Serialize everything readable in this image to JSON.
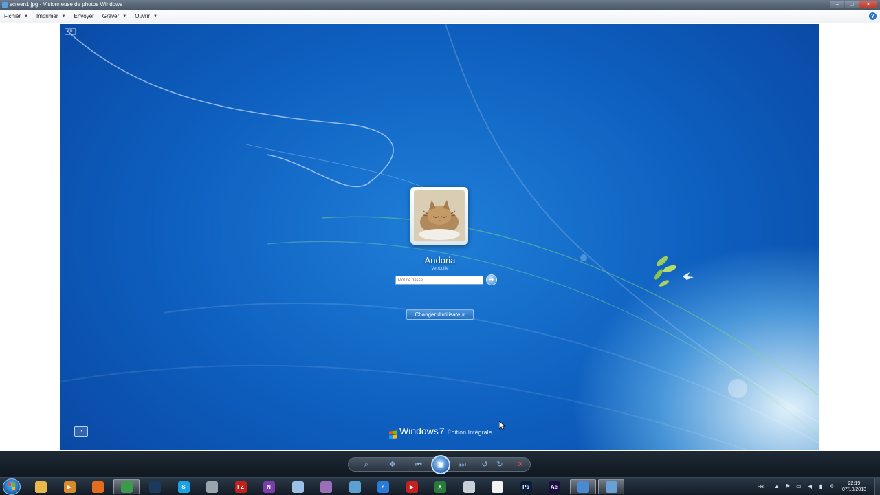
{
  "window": {
    "title": "screen1.jpg - Visionneuse de photos Windows"
  },
  "menu": {
    "items": [
      {
        "label": "Fichier",
        "has_arrow": true
      },
      {
        "label": "Imprimer",
        "has_arrow": true
      },
      {
        "label": "Envoyer",
        "has_arrow": false
      },
      {
        "label": "Graver",
        "has_arrow": true
      },
      {
        "label": "Ouvrir",
        "has_arrow": true
      }
    ],
    "help_label": "?"
  },
  "login": {
    "language_badge": "FR",
    "username": "Andoria",
    "status": "Verrouillé",
    "password_placeholder": "Mot de passe",
    "switch_user_label": "Changer d'utilisateur",
    "branding": {
      "name": "Windows",
      "version": "7",
      "edition": "Édition Intégrale"
    }
  },
  "taskbar": {
    "apps": [
      {
        "name": "explorer",
        "icon": "folder-icon",
        "color": "#e8b84a",
        "glyph": "",
        "active": false
      },
      {
        "name": "media-player",
        "icon": "media-player-icon",
        "color": "#d98a2a",
        "glyph": "▶",
        "active": false
      },
      {
        "name": "firefox",
        "icon": "firefox-icon",
        "color": "#e56b1f",
        "glyph": "",
        "active": false
      },
      {
        "name": "chrome",
        "icon": "chrome-icon",
        "color": "#3c9a4a",
        "glyph": "",
        "active": true
      },
      {
        "name": "steam",
        "icon": "steam-icon",
        "color": "#1b3a5e",
        "glyph": "",
        "active": false
      },
      {
        "name": "skype",
        "icon": "skype-icon",
        "color": "#1aa1e8",
        "glyph": "S",
        "active": false
      },
      {
        "name": "app-robot",
        "icon": "robot-icon",
        "color": "#9aa4ae",
        "glyph": "",
        "active": false
      },
      {
        "name": "filezilla",
        "icon": "filezilla-icon",
        "color": "#c4201b",
        "glyph": "FZ",
        "active": false
      },
      {
        "name": "onenote",
        "icon": "onenote-icon",
        "color": "#7a3ea8",
        "glyph": "N",
        "active": false
      },
      {
        "name": "virtualbox",
        "icon": "box-icon",
        "color": "#9cc0e8",
        "glyph": "",
        "active": false
      },
      {
        "name": "app-purple",
        "icon": "disc-icon",
        "color": "#9a6fb8",
        "glyph": "",
        "active": false
      },
      {
        "name": "app-pen",
        "icon": "pen-icon",
        "color": "#5aa0d0",
        "glyph": "",
        "active": false
      },
      {
        "name": "app-bolt",
        "icon": "bolt-icon",
        "color": "#2a7ad8",
        "glyph": "⚡",
        "active": false
      },
      {
        "name": "app-arrow",
        "icon": "arrow-icon",
        "color": "#c82020",
        "glyph": "▶",
        "active": false
      },
      {
        "name": "excel",
        "icon": "excel-icon",
        "color": "#2a7a3a",
        "glyph": "X",
        "active": false
      },
      {
        "name": "app-cube",
        "icon": "cube-icon",
        "color": "#c8d0d8",
        "glyph": "",
        "active": false
      },
      {
        "name": "app-white",
        "icon": "document-icon",
        "color": "#f2f2f2",
        "glyph": "",
        "active": false
      },
      {
        "name": "photoshop",
        "icon": "photoshop-icon",
        "color": "#0a1f3a",
        "glyph": "Ps",
        "active": false
      },
      {
        "name": "after-effects",
        "icon": "after-effects-icon",
        "color": "#1a1040",
        "glyph": "Ae",
        "active": false
      },
      {
        "name": "photo-viewer",
        "icon": "photo-viewer-icon",
        "color": "#4a8ad0",
        "glyph": "",
        "active": true
      },
      {
        "name": "app-network",
        "icon": "network-icon",
        "color": "#6aa0d8",
        "glyph": "",
        "active": true
      }
    ],
    "tray": {
      "language": "FR",
      "time": "22:19",
      "date": "07/10/2013"
    }
  }
}
